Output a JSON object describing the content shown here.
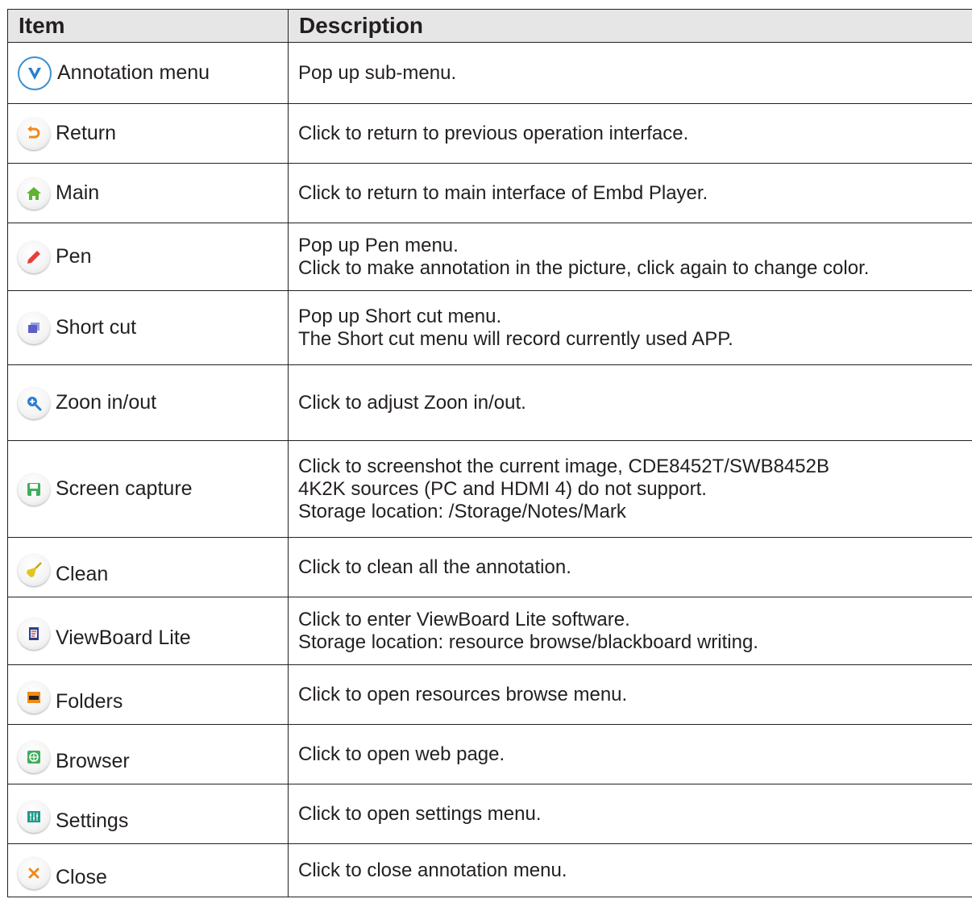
{
  "header": {
    "item": "Item",
    "description": "Description"
  },
  "rows": [
    {
      "icon": "annotation-v-icon",
      "label": "Annotation menu",
      "desc": [
        "Pop up sub-menu."
      ]
    },
    {
      "icon": "return-arrow-icon",
      "label": "Return",
      "desc": [
        "Click to return to previous operation interface."
      ]
    },
    {
      "icon": "home-icon",
      "label": "Main",
      "desc": [
        "Click to return to main interface of Embd Player."
      ]
    },
    {
      "icon": "pen-icon",
      "label": "Pen",
      "desc": [
        "Pop up Pen menu.",
        "Click to make annotation in the picture, click again to change color."
      ]
    },
    {
      "icon": "shortcut-windows-icon",
      "label": "Short cut",
      "desc": [
        "Pop up Short cut menu.",
        "The Short cut menu will record currently used APP."
      ]
    },
    {
      "icon": "zoom-icon",
      "label": "Zoon in/out",
      "desc": [
        "Click to adjust Zoon in/out."
      ]
    },
    {
      "icon": "save-floppy-icon",
      "label": "Screen capture",
      "desc": [
        "Click to screenshot the current image, CDE8452T/SWB8452B",
        "4K2K sources (PC and HDMI 4) do not support.",
        "Storage location: /Storage/Notes/Mark"
      ]
    },
    {
      "icon": "broom-icon",
      "label": "Clean",
      "desc": [
        "Click to clean all the annotation."
      ]
    },
    {
      "icon": "viewboard-icon",
      "label": "ViewBoard Lite",
      "desc": [
        "Click to enter ViewBoard Lite software.",
        "Storage location: resource browse/blackboard writing."
      ]
    },
    {
      "icon": "folder-icon",
      "label": "Folders",
      "desc": [
        "Click to open resources browse menu."
      ]
    },
    {
      "icon": "browser-globe-icon",
      "label": "Browser",
      "desc": [
        "Click to open web page."
      ]
    },
    {
      "icon": "settings-sliders-icon",
      "label": "Settings",
      "desc": [
        "Click to open settings menu."
      ]
    },
    {
      "icon": "close-x-icon",
      "label": "Close",
      "desc": [
        "Click to close annotation menu."
      ]
    }
  ]
}
